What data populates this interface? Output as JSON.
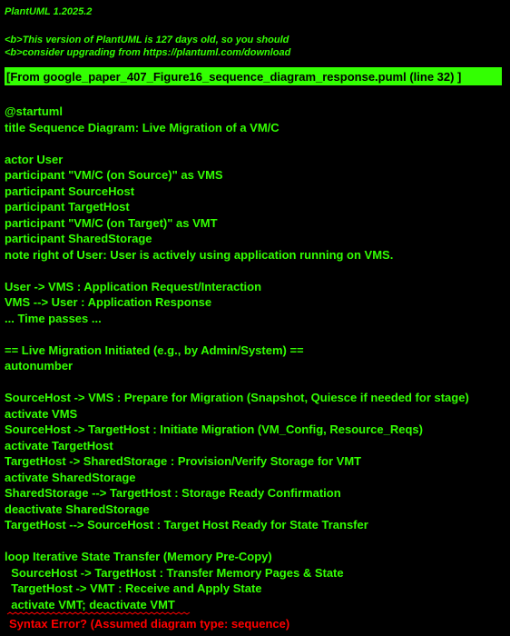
{
  "header": {
    "version": "PlantUML 1.2025.2",
    "warning_1": "<b>This version of PlantUML is 127 days old, so you should",
    "warning_2": "<b>consider upgrading from https://plantuml.com/download"
  },
  "banner": {
    "text": "[From google_paper_407_Figure16_sequence_diagram_response.puml (line 32) ]"
  },
  "source_lines": [
    "@startuml",
    "title Sequence Diagram: Live Migration of a VM/C",
    "",
    "actor User",
    "participant \"VM/C (on Source)\" as VMS",
    "participant SourceHost",
    "participant TargetHost",
    "participant \"VM/C (on Target)\" as VMT",
    "participant SharedStorage",
    "note right of User: User is actively using application running on VMS.",
    "",
    "User -> VMS : Application Request/Interaction",
    "VMS --> User : Application Response",
    "... Time passes ...",
    "",
    "== Live Migration Initiated (e.g., by Admin/System) ==",
    "autonumber",
    "",
    "SourceHost -> VMS : Prepare for Migration (Snapshot, Quiesce if needed for stage)",
    "activate VMS",
    "SourceHost -> TargetHost : Initiate Migration (VM_Config, Resource_Reqs)",
    "activate TargetHost",
    "TargetHost -> SharedStorage : Provision/Verify Storage for VMT",
    "activate SharedStorage",
    "SharedStorage --> TargetHost : Storage Ready Confirmation",
    "deactivate SharedStorage",
    "TargetHost --> SourceHost : Target Host Ready for State Transfer",
    "",
    "loop Iterative State Transfer (Memory Pre-Copy)",
    "  SourceHost -> TargetHost : Transfer Memory Pages & State",
    "  TargetHost -> VMT : Receive and Apply State",
    "  activate VMT; deactivate VMT"
  ],
  "error": {
    "text": "Syntax Error? (Assumed diagram type: sequence)"
  },
  "colors": {
    "text": "#33ff02",
    "background": "#000000",
    "error": "#ff0000"
  }
}
